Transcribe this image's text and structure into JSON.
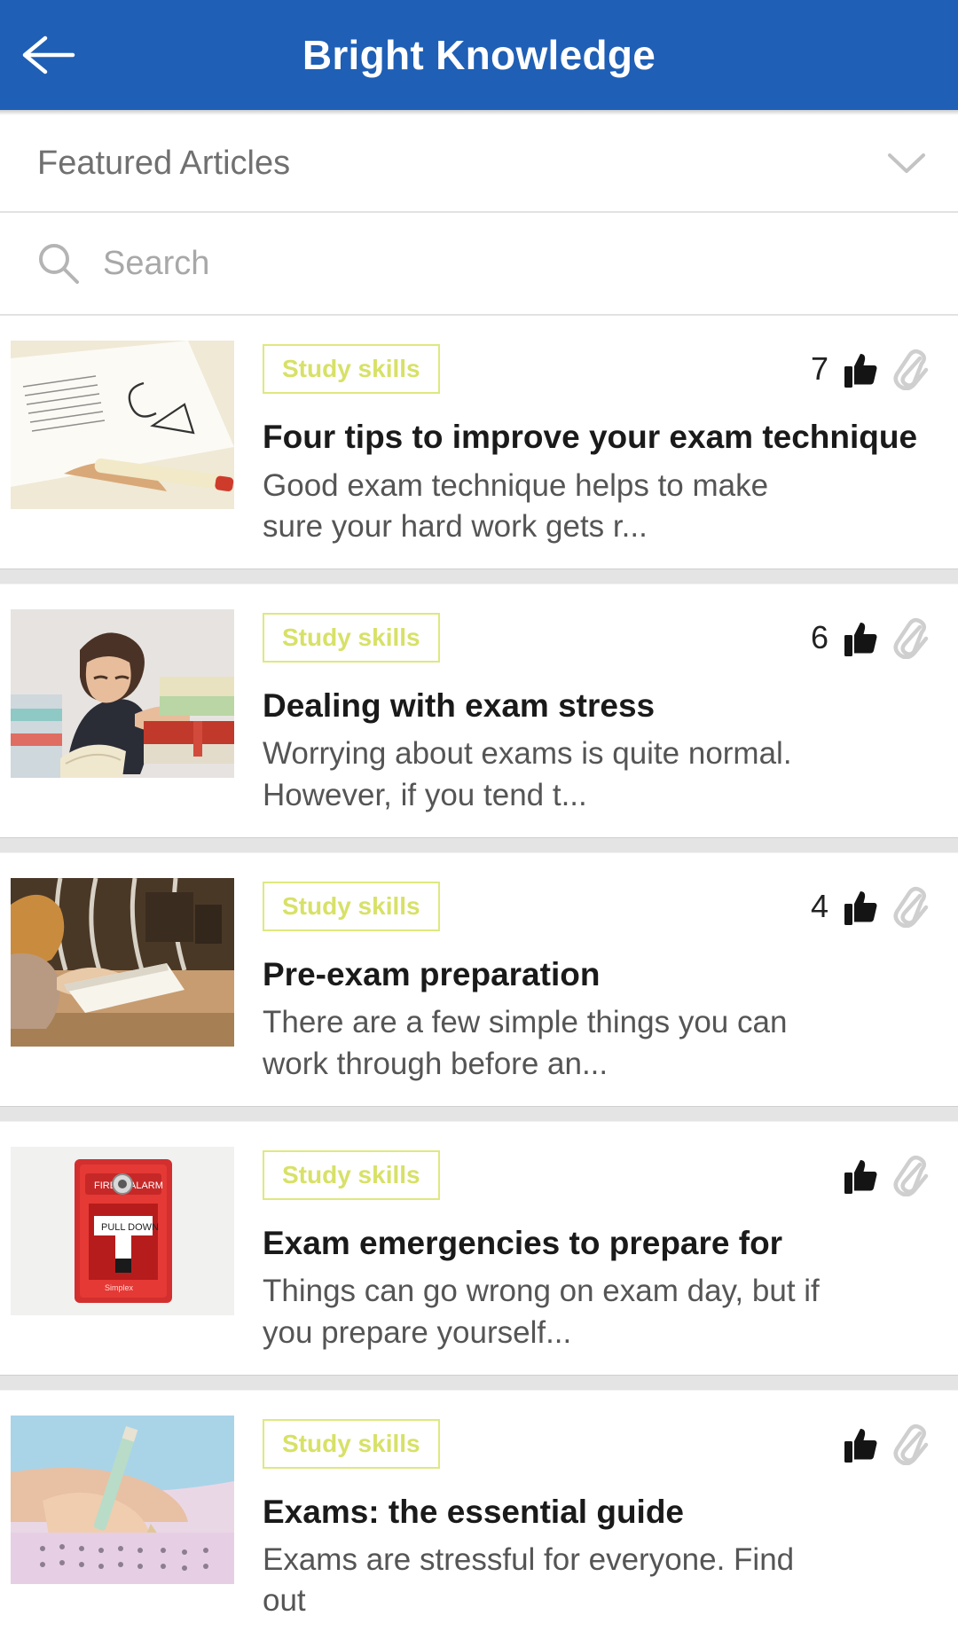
{
  "appbar": {
    "title": "Bright Knowledge",
    "back_icon": "arrow-left-icon",
    "background_color": "#1f5fb5"
  },
  "section": {
    "title": "Featured Articles",
    "expand_icon": "chevron-down-icon"
  },
  "search": {
    "placeholder": "Search",
    "value": "",
    "icon": "search-icon"
  },
  "theme": {
    "badge_color": "#d7e167",
    "badge_border": "#dfe87f",
    "title_color": "#1a1a1a",
    "desc_color": "#555555",
    "divider_color": "#e4e4e4"
  },
  "articles": [
    {
      "badge": "Study skills",
      "likes": "7",
      "title": "Four tips to improve your exam technique",
      "desc": "Good exam technique helps to make sure your hard work gets r...",
      "thumb_alt": "hand-writing-on-paper-photo"
    },
    {
      "badge": "Study skills",
      "likes": "6",
      "title": "Dealing with exam stress",
      "desc": "Worrying about exams is quite normal. However, if you tend t...",
      "thumb_alt": "student-resting-on-books-photo"
    },
    {
      "badge": "Study skills",
      "likes": "4",
      "title": "Pre-exam preparation",
      "desc": "There are a few simple things you can work through before an...",
      "thumb_alt": "student-reading-book-in-hall-photo"
    },
    {
      "badge": "Study skills",
      "likes": "",
      "title": "Exam emergencies to prepare for",
      "desc": "Things can go wrong on exam day, but if you prepare yourself...",
      "thumb_alt": "red-fire-alarm-pull-station-photo"
    },
    {
      "badge": "Study skills",
      "likes": "",
      "title": "Exams: the essential guide",
      "desc": "Exams are stressful for everyone. Find out",
      "thumb_alt": "hand-filling-answer-sheet-photo"
    }
  ],
  "icons": {
    "like": "thumbs-up-icon",
    "attachment": "paperclip-icon"
  }
}
